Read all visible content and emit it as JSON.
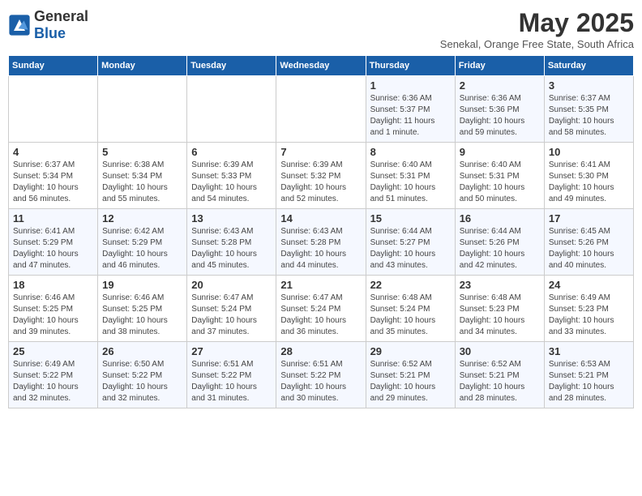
{
  "logo": {
    "general": "General",
    "blue": "Blue"
  },
  "title": "May 2025",
  "location": "Senekal, Orange Free State, South Africa",
  "days_of_week": [
    "Sunday",
    "Monday",
    "Tuesday",
    "Wednesday",
    "Thursday",
    "Friday",
    "Saturday"
  ],
  "weeks": [
    [
      {
        "day": "",
        "content": ""
      },
      {
        "day": "",
        "content": ""
      },
      {
        "day": "",
        "content": ""
      },
      {
        "day": "",
        "content": ""
      },
      {
        "day": "1",
        "content": "Sunrise: 6:36 AM\nSunset: 5:37 PM\nDaylight: 11 hours and 1 minute."
      },
      {
        "day": "2",
        "content": "Sunrise: 6:36 AM\nSunset: 5:36 PM\nDaylight: 10 hours and 59 minutes."
      },
      {
        "day": "3",
        "content": "Sunrise: 6:37 AM\nSunset: 5:35 PM\nDaylight: 10 hours and 58 minutes."
      }
    ],
    [
      {
        "day": "4",
        "content": "Sunrise: 6:37 AM\nSunset: 5:34 PM\nDaylight: 10 hours and 56 minutes."
      },
      {
        "day": "5",
        "content": "Sunrise: 6:38 AM\nSunset: 5:34 PM\nDaylight: 10 hours and 55 minutes."
      },
      {
        "day": "6",
        "content": "Sunrise: 6:39 AM\nSunset: 5:33 PM\nDaylight: 10 hours and 54 minutes."
      },
      {
        "day": "7",
        "content": "Sunrise: 6:39 AM\nSunset: 5:32 PM\nDaylight: 10 hours and 52 minutes."
      },
      {
        "day": "8",
        "content": "Sunrise: 6:40 AM\nSunset: 5:31 PM\nDaylight: 10 hours and 51 minutes."
      },
      {
        "day": "9",
        "content": "Sunrise: 6:40 AM\nSunset: 5:31 PM\nDaylight: 10 hours and 50 minutes."
      },
      {
        "day": "10",
        "content": "Sunrise: 6:41 AM\nSunset: 5:30 PM\nDaylight: 10 hours and 49 minutes."
      }
    ],
    [
      {
        "day": "11",
        "content": "Sunrise: 6:41 AM\nSunset: 5:29 PM\nDaylight: 10 hours and 47 minutes."
      },
      {
        "day": "12",
        "content": "Sunrise: 6:42 AM\nSunset: 5:29 PM\nDaylight: 10 hours and 46 minutes."
      },
      {
        "day": "13",
        "content": "Sunrise: 6:43 AM\nSunset: 5:28 PM\nDaylight: 10 hours and 45 minutes."
      },
      {
        "day": "14",
        "content": "Sunrise: 6:43 AM\nSunset: 5:28 PM\nDaylight: 10 hours and 44 minutes."
      },
      {
        "day": "15",
        "content": "Sunrise: 6:44 AM\nSunset: 5:27 PM\nDaylight: 10 hours and 43 minutes."
      },
      {
        "day": "16",
        "content": "Sunrise: 6:44 AM\nSunset: 5:26 PM\nDaylight: 10 hours and 42 minutes."
      },
      {
        "day": "17",
        "content": "Sunrise: 6:45 AM\nSunset: 5:26 PM\nDaylight: 10 hours and 40 minutes."
      }
    ],
    [
      {
        "day": "18",
        "content": "Sunrise: 6:46 AM\nSunset: 5:25 PM\nDaylight: 10 hours and 39 minutes."
      },
      {
        "day": "19",
        "content": "Sunrise: 6:46 AM\nSunset: 5:25 PM\nDaylight: 10 hours and 38 minutes."
      },
      {
        "day": "20",
        "content": "Sunrise: 6:47 AM\nSunset: 5:24 PM\nDaylight: 10 hours and 37 minutes."
      },
      {
        "day": "21",
        "content": "Sunrise: 6:47 AM\nSunset: 5:24 PM\nDaylight: 10 hours and 36 minutes."
      },
      {
        "day": "22",
        "content": "Sunrise: 6:48 AM\nSunset: 5:24 PM\nDaylight: 10 hours and 35 minutes."
      },
      {
        "day": "23",
        "content": "Sunrise: 6:48 AM\nSunset: 5:23 PM\nDaylight: 10 hours and 34 minutes."
      },
      {
        "day": "24",
        "content": "Sunrise: 6:49 AM\nSunset: 5:23 PM\nDaylight: 10 hours and 33 minutes."
      }
    ],
    [
      {
        "day": "25",
        "content": "Sunrise: 6:49 AM\nSunset: 5:22 PM\nDaylight: 10 hours and 32 minutes."
      },
      {
        "day": "26",
        "content": "Sunrise: 6:50 AM\nSunset: 5:22 PM\nDaylight: 10 hours and 32 minutes."
      },
      {
        "day": "27",
        "content": "Sunrise: 6:51 AM\nSunset: 5:22 PM\nDaylight: 10 hours and 31 minutes."
      },
      {
        "day": "28",
        "content": "Sunrise: 6:51 AM\nSunset: 5:22 PM\nDaylight: 10 hours and 30 minutes."
      },
      {
        "day": "29",
        "content": "Sunrise: 6:52 AM\nSunset: 5:21 PM\nDaylight: 10 hours and 29 minutes."
      },
      {
        "day": "30",
        "content": "Sunrise: 6:52 AM\nSunset: 5:21 PM\nDaylight: 10 hours and 28 minutes."
      },
      {
        "day": "31",
        "content": "Sunrise: 6:53 AM\nSunset: 5:21 PM\nDaylight: 10 hours and 28 minutes."
      }
    ]
  ]
}
